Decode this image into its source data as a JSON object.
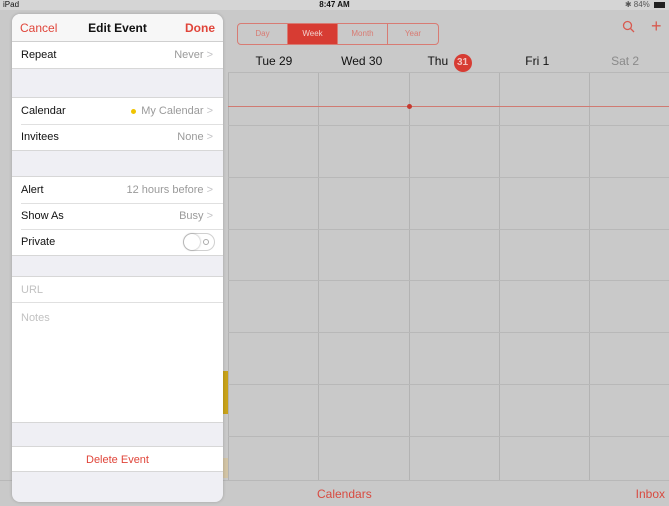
{
  "status_bar": {
    "device": "iPad",
    "time": "8:47 AM",
    "battery": "84%"
  },
  "calendar": {
    "view_tabs": [
      {
        "label": "Day",
        "active": false
      },
      {
        "label": "Week",
        "active": true
      },
      {
        "label": "Month",
        "active": false
      },
      {
        "label": "Year",
        "active": false
      }
    ],
    "days": [
      {
        "label": "Tue 29"
      },
      {
        "label": "Wed 30"
      },
      {
        "label": "Thu",
        "badge": "31"
      },
      {
        "label": "Fri 1"
      },
      {
        "label": "Sat 2"
      }
    ],
    "bottom": {
      "calendars": "Calendars",
      "inbox": "Inbox"
    },
    "accent_color": "#d73c33"
  },
  "edit_event": {
    "cancel": "Cancel",
    "title": "Edit Event",
    "done": "Done",
    "repeat": {
      "label": "Repeat",
      "value": "Never"
    },
    "calendar": {
      "label": "Calendar",
      "value": "My Calendar",
      "dot_color": "#f0c400"
    },
    "invitees": {
      "label": "Invitees",
      "value": "None"
    },
    "alert": {
      "label": "Alert",
      "value": "12 hours before"
    },
    "show_as": {
      "label": "Show As",
      "value": "Busy"
    },
    "private": {
      "label": "Private",
      "on": false
    },
    "url_placeholder": "URL",
    "notes_placeholder": "Notes",
    "delete": "Delete Event"
  }
}
